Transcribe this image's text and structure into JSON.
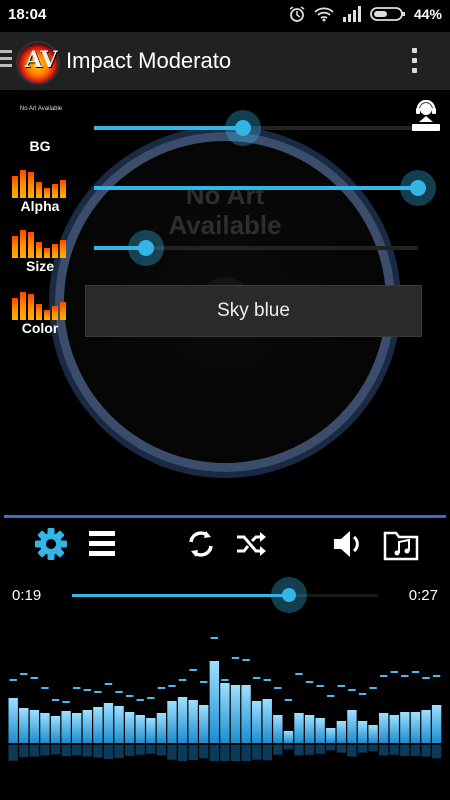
{
  "status": {
    "time": "18:04",
    "battery": "44%"
  },
  "app": {
    "title": "Impact Moderato"
  },
  "album_art": {
    "line1": "No Art",
    "line2": "Available"
  },
  "settings": {
    "thumbnail_text": "No Art Available",
    "labels": {
      "bg": "BG",
      "alpha": "Alpha",
      "size": "Size",
      "color": "Color"
    },
    "bg_level": 0.46,
    "alpha_level": 1.0,
    "size_level": 0.16,
    "color_value": "Sky blue"
  },
  "player": {
    "elapsed": "0:19",
    "total": "0:27",
    "progress": 0.71
  },
  "colors": {
    "accent": "#33b5e5",
    "divider": "#3f6bd0",
    "eq_gradient": [
      "#ff4500",
      "#ffb000"
    ]
  },
  "icons": [
    "menu-icon",
    "app-logo",
    "overflow-icon",
    "dj-icon",
    "gear-icon",
    "playlist-icon",
    "repeat-icon",
    "shuffle-icon",
    "volume-icon",
    "music-folder-icon"
  ],
  "visualizer": {
    "bars": [
      45,
      35,
      33,
      30,
      27,
      32,
      30,
      33,
      36,
      40,
      37,
      31,
      28,
      25,
      30,
      42,
      46,
      43,
      38,
      82,
      60,
      58,
      58,
      42,
      44,
      28,
      12,
      30,
      28,
      25,
      15,
      22,
      33,
      22,
      18,
      30,
      28,
      31,
      31,
      33,
      38
    ],
    "peaks": [
      64,
      70,
      66,
      56,
      44,
      42,
      56,
      54,
      52,
      60,
      52,
      48,
      44,
      46,
      56,
      58,
      64,
      74,
      62,
      106,
      64,
      86,
      84,
      66,
      64,
      56,
      44,
      70,
      62,
      58,
      48,
      58,
      54,
      50,
      56,
      68,
      72,
      68,
      72,
      66,
      68
    ]
  }
}
